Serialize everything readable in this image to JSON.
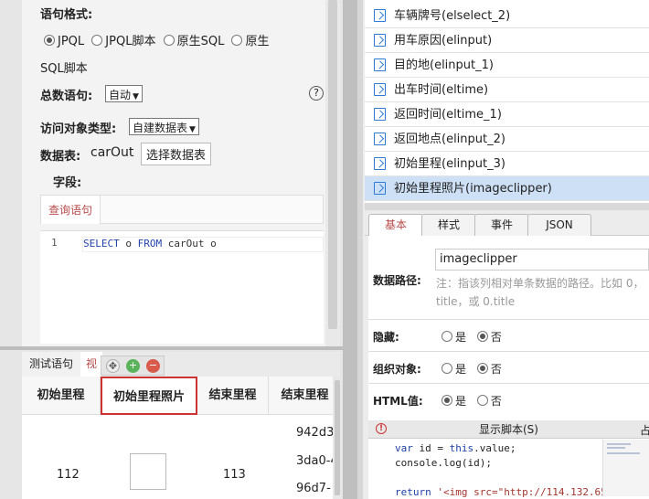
{
  "left": {
    "stmt_format_label": "语句格式:",
    "format_options": [
      "JPQL",
      "JPQL脚本",
      "原生SQL",
      "原生"
    ],
    "format_selected": 0,
    "format_wrap": "SQL脚本",
    "count_label": "总数语句:",
    "count_value": "自动",
    "help_glyph": "?",
    "access_label": "访问对象类型:",
    "access_value": "自建数据表",
    "table_label": "数据表:",
    "table_value": "carOut",
    "choose_table_btn": "选择数据表",
    "fields_label": "字段:",
    "query_tab": "查询语句",
    "editor": {
      "line_no": "1",
      "kw1": "SELECT",
      "mid": " o ",
      "kw2": "FROM",
      "rest": " carOut o"
    }
  },
  "bottom_left": {
    "tab_test": "测试语句",
    "tab_view": "视",
    "columns": [
      "初始里程",
      "初始里程照片",
      "结束里程",
      "结束里程"
    ],
    "row": {
      "start": "112",
      "end": "113",
      "ids": [
        "942d3",
        "3da0-4",
        "96d7-"
      ]
    }
  },
  "field_list": [
    "车辆牌号(elselect_2)",
    "用车原因(elinput)",
    "目的地(elinput_1)",
    "出车时间(eltime)",
    "返回时间(eltime_1)",
    "返回地点(elinput_2)",
    "初始里程(elinput_3)",
    "初始里程照片(imageclipper)"
  ],
  "field_list_active": 7,
  "props": {
    "tabs": [
      "基本",
      "样式",
      "事件",
      "JSON"
    ],
    "active_tab": 0,
    "data_path_label": "数据路径:",
    "data_path_value": "imageclipper",
    "data_path_hint": "注：指该列相对单条数据的路径。比如 0，title，或 0.title",
    "hidden_label": "隐藏:",
    "group_label": "组织对象:",
    "html_label": "HTML值:",
    "yes": "是",
    "no": "否",
    "hidden_value": "否",
    "group_value": "否",
    "html_value": "是",
    "show_script": "显示脚本(S)",
    "corner_glyph": "占",
    "code_lines": [
      {
        "kw": "var",
        "text": " id = ",
        "kw_b": "this",
        "text2": ".value;"
      },
      {
        "text": "console.log(id);"
      },
      {
        "kw": "return",
        "str": " '<img src=\"http://114.132.65"
      }
    ]
  },
  "colors": {
    "accent_red": "#b84a4a",
    "active_row": "#cde0f5",
    "icon_blue": "#2d7bd6"
  }
}
